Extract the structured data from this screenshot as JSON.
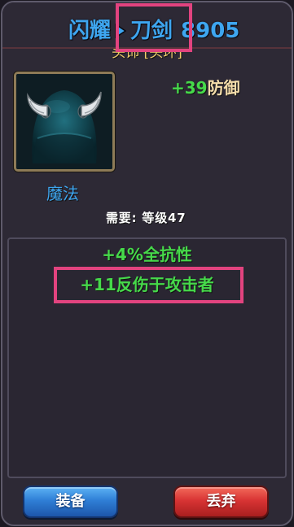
{
  "title": {
    "prefix": "闪耀",
    "arrow_icon": "triangle-right-icon",
    "name": "刀剑",
    "power": "8905"
  },
  "item": {
    "slot": "头饰 [头环]",
    "icon": "horned-helmet-icon",
    "main_stat": {
      "value": "+39",
      "label": "防御"
    },
    "type": "魔法",
    "requirement": "需要: 等级47"
  },
  "affixes": [
    {
      "value": "+4%",
      "label": "全抗性"
    },
    {
      "value": "+11",
      "label": "反伤于攻击者"
    }
  ],
  "buttons": {
    "equip": "装备",
    "discard": "丢弃"
  },
  "colors": {
    "title_blue": "#3ea6f0",
    "slot_yellow": "#f1cd6c",
    "stat_green": "#46d94a",
    "stat_label": "#f4dcaa",
    "requirement_white": "#ffffff",
    "highlight_pink": "#e2437f",
    "equip_blue": "#2f7fd6",
    "discard_red": "#d83434"
  }
}
